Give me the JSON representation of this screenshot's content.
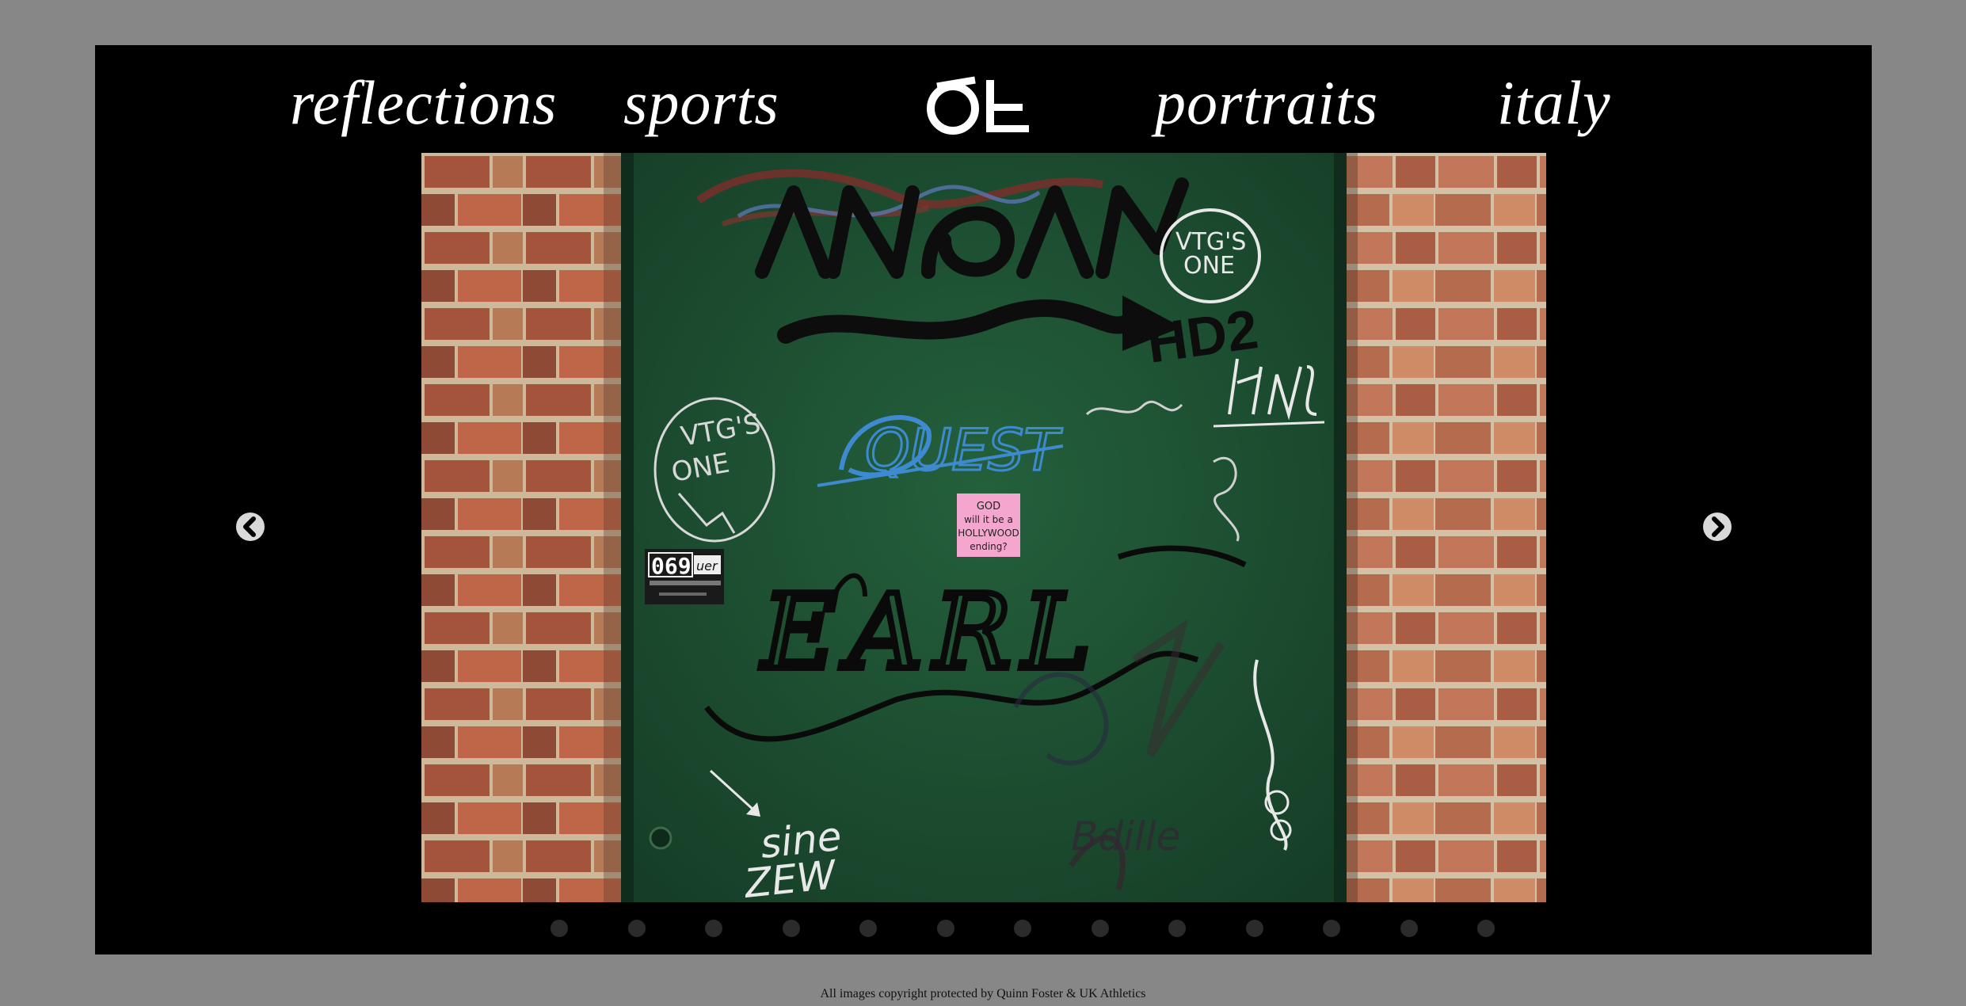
{
  "nav": {
    "left": [
      {
        "label": "reflections"
      },
      {
        "label": "sports"
      }
    ],
    "logo_text": "ØE",
    "right": [
      {
        "label": "portraits"
      },
      {
        "label": "italy"
      }
    ]
  },
  "slideshow": {
    "total_slides": 13,
    "prev_icon": "chevron-left-circle-icon",
    "next_icon": "chevron-right-circle-icon"
  },
  "photo": {
    "sticker_pink": [
      "GOD",
      "will it be a",
      "HOLLYWOOD",
      "ending?"
    ],
    "sticker_black": [
      "069",
      "uer"
    ],
    "graffiti": [
      "EARL",
      "VTG'S ONE",
      "QUEST",
      "HD2",
      "sine ZEW",
      "VTG'S ONE"
    ]
  },
  "footer": {
    "copyright": "All images copyright protected by Quinn Foster & UK Athletics"
  },
  "colors": {
    "page_bg": "#878787",
    "frame_bg": "#000000",
    "door_green": "#1f5234",
    "sticker_pink": "#f4a6cf"
  }
}
